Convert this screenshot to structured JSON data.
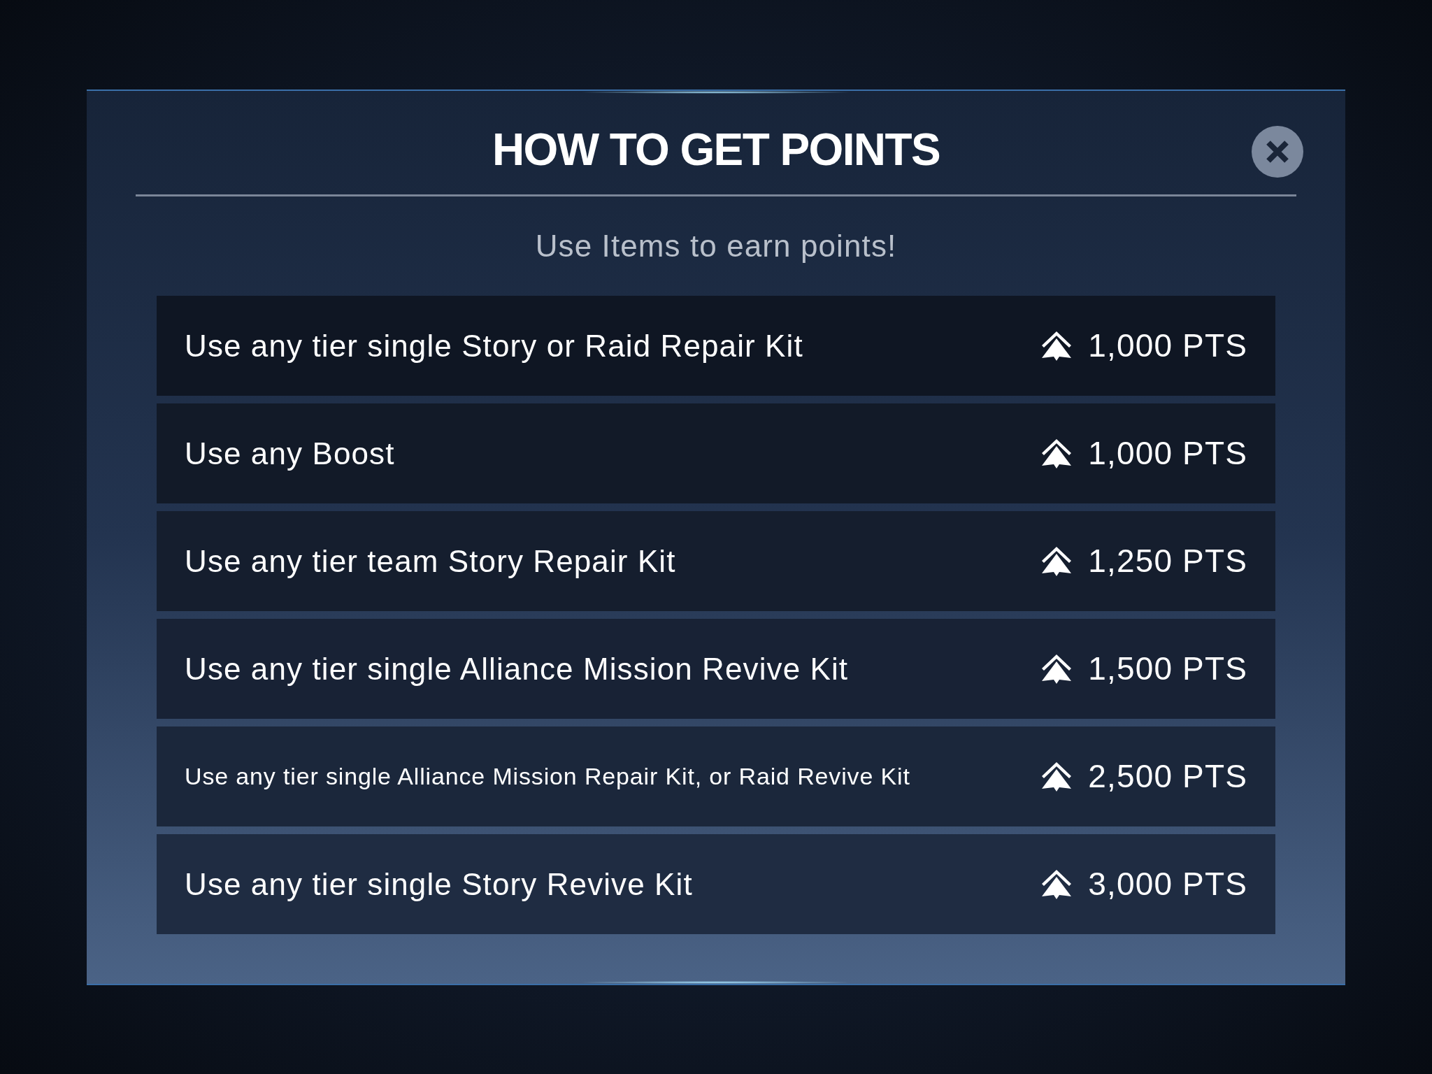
{
  "dialog": {
    "title": "HOW TO GET POINTS",
    "subtitle": "Use Items to earn points!"
  },
  "rows": [
    {
      "description": "Use any tier single Story or Raid Repair Kit",
      "points": "1,000 PTS"
    },
    {
      "description": "Use any Boost",
      "points": "1,000 PTS"
    },
    {
      "description": "Use any tier team Story Repair Kit",
      "points": "1,250 PTS"
    },
    {
      "description": "Use any tier single Alliance Mission Revive Kit",
      "points": "1,500 PTS"
    },
    {
      "description": "Use any tier single Alliance Mission Repair Kit, or Raid Revive Kit",
      "points": "2,500 PTS"
    },
    {
      "description": "Use any tier single Story Revive Kit",
      "points": "3,000 PTS"
    }
  ]
}
